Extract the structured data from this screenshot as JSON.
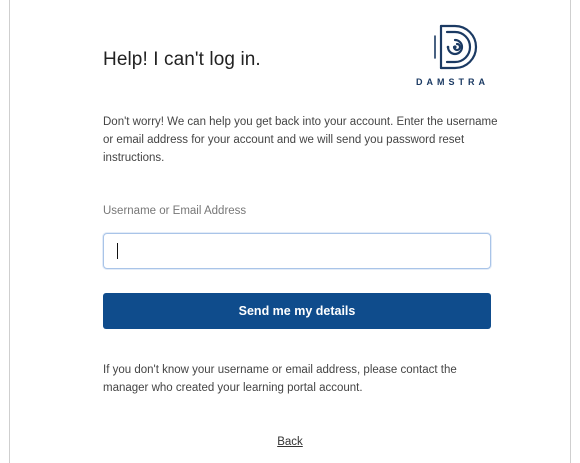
{
  "page": {
    "title": "Help! I can't log in."
  },
  "logo": {
    "wordmark": "DAMSTRA",
    "icon": "damstra-logo-icon",
    "color": "#1b3a63"
  },
  "description": "Don't worry! We can help you get back into your account. Enter the username or email address for your account and we will send you password reset instructions.",
  "form": {
    "field_label": "Username or Email Address",
    "field_value": "",
    "submit_label": "Send me my details",
    "submit_color": "#0f4c8c"
  },
  "help_text": "If you don't know your username or email address, please contact the manager who created your learning portal account.",
  "back_link": "Back"
}
